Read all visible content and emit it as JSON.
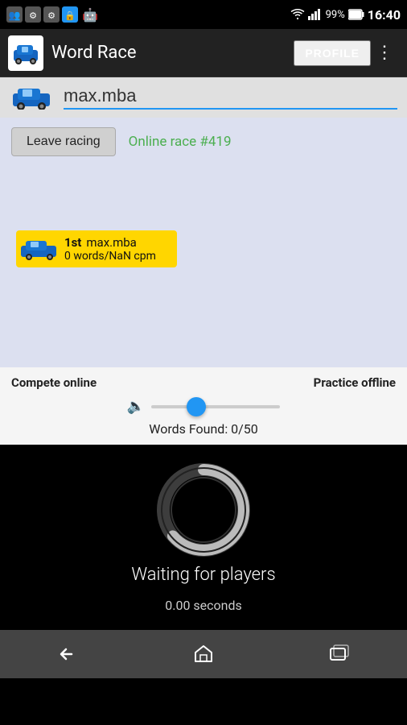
{
  "statusBar": {
    "time": "16:40",
    "battery": "99%"
  },
  "appBar": {
    "title": "Word Race",
    "profileLabel": "PROFILE"
  },
  "usernameBar": {
    "username": "max.mba"
  },
  "raceControls": {
    "leaveRacingLabel": "Leave racing",
    "onlineRaceLabel": "Online race #419"
  },
  "playerCard": {
    "position": "1st",
    "name": "max.mba",
    "stats": "0 words/NaN cpm"
  },
  "bottomControls": {
    "competeOnlineLabel": "Compete online",
    "practiceOfflineLabel": "Practice offline",
    "wordsFoundLabel": "Words Found: 0/50"
  },
  "waitingArea": {
    "waitingText": "Waiting for players",
    "secondsText": "0.00 seconds"
  },
  "navBar": {
    "backLabel": "Back",
    "homeLabel": "Home",
    "recentLabel": "Recent"
  }
}
